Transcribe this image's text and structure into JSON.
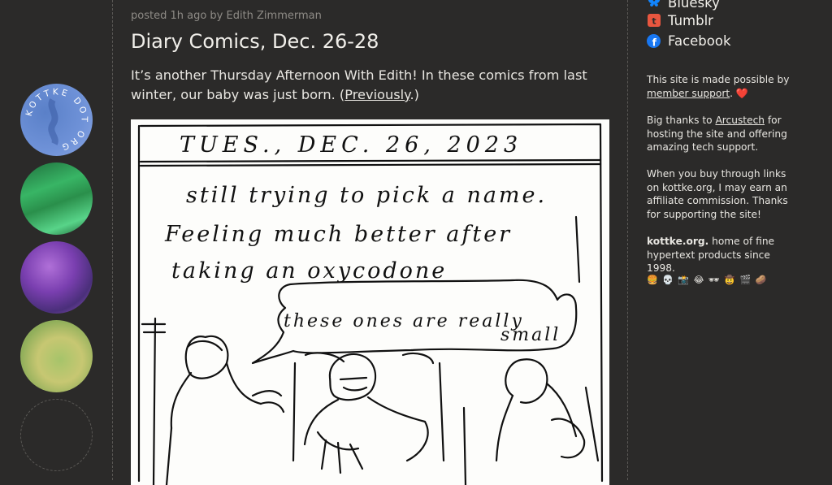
{
  "rail": {
    "badge_text": "KOTTKE DOT ORG"
  },
  "post": {
    "meta": "posted 1h ago by Edith Zimmerman",
    "title": "Diary Comics, Dec. 26-28",
    "intro_text": "It’s another Thursday Afternoon With Edith! In these comics from last winter, our baby was just born. (",
    "previously_label": "Previously",
    "intro_end": ".)"
  },
  "comic": {
    "date": "TUES., DEC. 26, 2023",
    "line1": "still trying to pick a name.",
    "line2": "Feeling much better after",
    "line3": "taking an oxycodone",
    "bubble1": "these ones are really",
    "bubble2": "small"
  },
  "sidebar": {
    "social": [
      {
        "label": "Bluesky",
        "icon": "bluesky-icon"
      },
      {
        "label": "Tumblr",
        "icon": "tumblr-icon"
      },
      {
        "label": "Facebook",
        "icon": "facebook-icon"
      }
    ],
    "support_pre": "This site is made possible by ",
    "support_link": "member support",
    "support_post": ". ❤️",
    "thanks_pre": "Big thanks to ",
    "thanks_link": "Arcustech",
    "thanks_post": " for hosting the site and offering amazing tech support.",
    "affiliate": "When you buy through links on kottke.org, I may earn an affiliate commission. Thanks for supporting the site!",
    "tag_bold": "kottke.org.",
    "tag_rest": " home of fine hypertext products since 1998.",
    "emojis": "🍔 💀 📸 😂 🕶 🤠 🎬 🥔"
  },
  "colors": {
    "background": "#2b2a29",
    "text": "#e8e6e1",
    "muted": "#8e8b86",
    "bluesky": "#1185fe",
    "tumblr": "#e8563f",
    "facebook": "#1877f2"
  }
}
